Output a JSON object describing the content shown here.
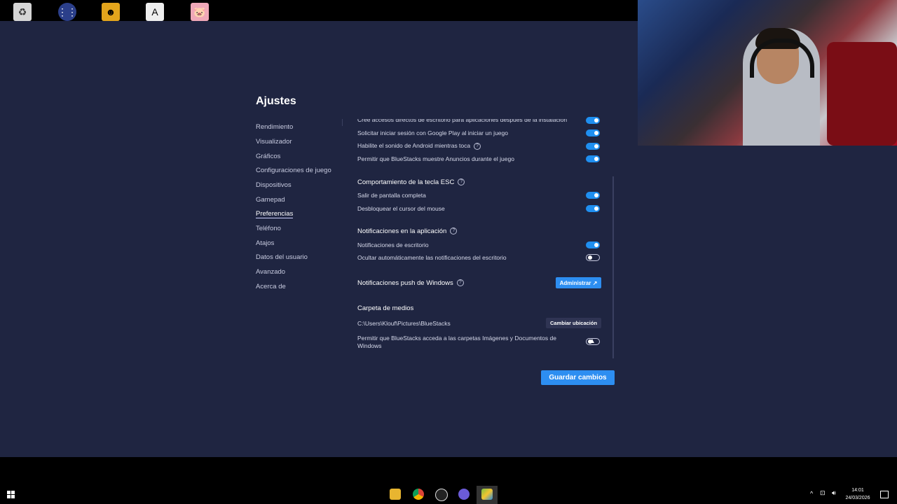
{
  "settings": {
    "title": "Ajustes",
    "nav": [
      {
        "label": "Rendimiento"
      },
      {
        "label": "Visualizador"
      },
      {
        "label": "Gráficos"
      },
      {
        "label": "Configuraciones de juego"
      },
      {
        "label": "Dispositivos"
      },
      {
        "label": "Gamepad"
      },
      {
        "label": "Preferencias",
        "active": true
      },
      {
        "label": "Teléfono"
      },
      {
        "label": "Atajos"
      },
      {
        "label": "Datos del usuario"
      },
      {
        "label": "Avanzado"
      },
      {
        "label": "Acerca de"
      }
    ],
    "rows": {
      "cut": "Cree accesos directos de escritorio para aplicaciones después de la instalación",
      "google_play": "Solicitar iniciar sesión con Google Play al iniciar un juego",
      "android_sound": "Habilite el sonido de Android mientras toca",
      "ads": "Permitir que BlueStacks muestre Anuncios durante el juego",
      "esc_header": "Comportamiento de la tecla ESC",
      "exit_full": "Salir de pantalla completa",
      "unlock_cursor": "Desbloquear el cursor del mouse",
      "notif_header": "Notificaciones en la aplicación",
      "desktop_notif": "Notificaciones de escritorio",
      "hide_notif": "Ocultar automáticamente las notificaciones del escritorio",
      "push_header": "Notificaciones push de Windows",
      "media_header": "Carpeta de medios",
      "media_path": "C:\\Users\\Klouf\\Pictures\\BlueStacks",
      "allow_folders": "Permitir que BlueStacks acceda a las carpetas Imágenes y Documentos de Windows"
    },
    "buttons": {
      "admin": "Administrar ↗",
      "change_location": "Cambiar ubicación",
      "save": "Guardar cambios"
    },
    "toggles": {
      "cut": true,
      "google_play": true,
      "android_sound": true,
      "ads": true,
      "exit_full": true,
      "unlock_cursor": true,
      "desktop_notif": true,
      "hide_notif": false,
      "allow_folders": false
    }
  },
  "taskbar": {
    "time": "14:01",
    "date": "24/03/2026"
  },
  "colors": {
    "background": "#1f2541",
    "accent": "#2d8ef1"
  }
}
